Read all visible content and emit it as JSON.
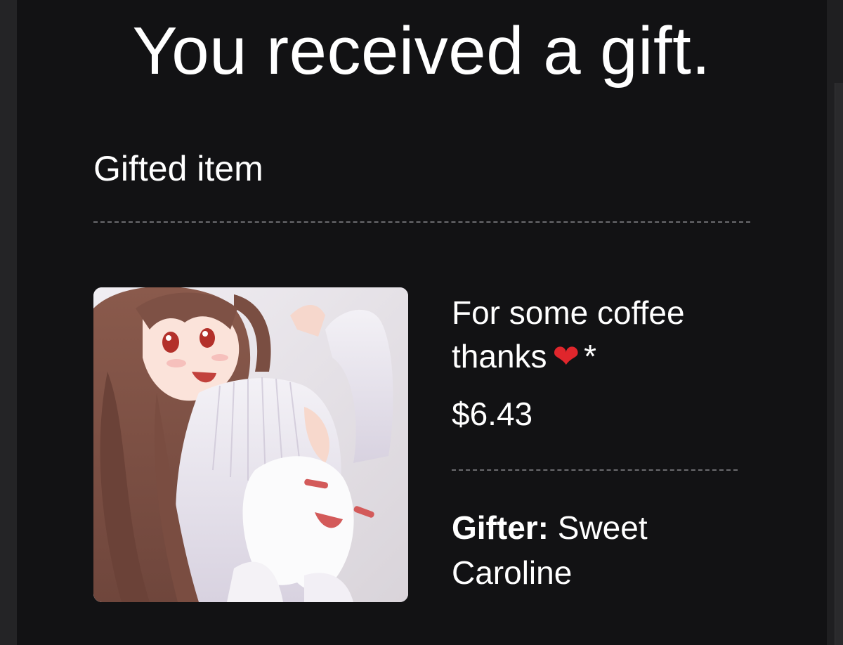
{
  "header": {
    "title": "You received a gift."
  },
  "section": {
    "label": "Gifted item"
  },
  "item": {
    "image_alt": "Gift item artwork",
    "name_text": "For some coffee thanks",
    "name_emoji": "❤",
    "name_suffix": "*",
    "price": "$6.43"
  },
  "gifter": {
    "label": "Gifter:",
    "name": "Sweet Caroline"
  },
  "colors": {
    "background": "#121214",
    "text": "#ffffff",
    "divider": "#6a6a6e",
    "heart": "#e0262c"
  }
}
